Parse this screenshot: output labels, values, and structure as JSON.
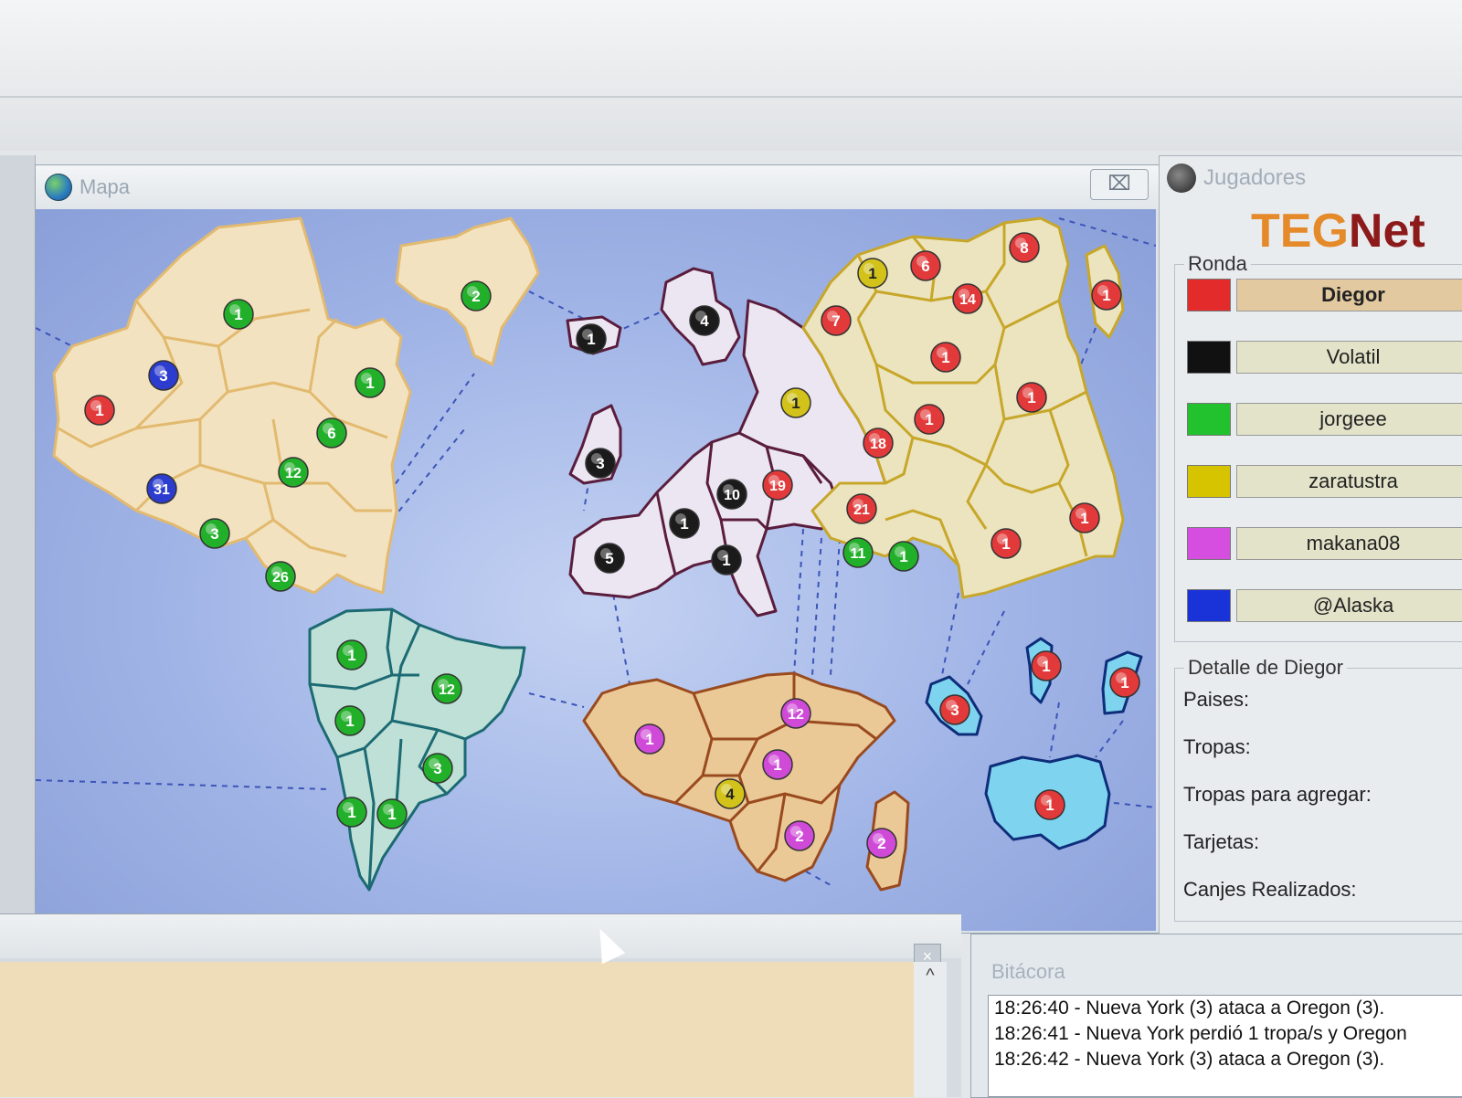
{
  "map_window": {
    "title": "Mapa",
    "close_label": "⌧"
  },
  "players_window": {
    "title": "Jugadores",
    "logo": {
      "teg": "TEG",
      "net": "Net"
    },
    "round_label": "Ronda",
    "players": [
      {
        "name": "Diegor",
        "color": "#e42b2b",
        "active": true
      },
      {
        "name": "Volatil",
        "color": "#111111",
        "active": false
      },
      {
        "name": "jorgeee",
        "color": "#22c22e",
        "active": false
      },
      {
        "name": "zaratustra",
        "color": "#d6c400",
        "active": false
      },
      {
        "name": "makana08",
        "color": "#d54ee0",
        "active": false
      },
      {
        "name": "@Alaska",
        "color": "#1a33d8",
        "active": false
      }
    ],
    "detail": {
      "title": "Detalle de Diegor",
      "labels": [
        "Paises:",
        "Tropas:",
        "Tropas para agregar:",
        "Tarjetas:",
        "Canjes Realizados:"
      ]
    }
  },
  "log_window": {
    "title": "Bitácora",
    "lines": [
      "18:26:40 - Nueva York (3) ataca a Oregon (3).",
      "18:26:41 - Nueva York perdió 1 tropa/s y Oregon",
      "18:26:42 - Nueva York (3) ataca a Oregon (3)."
    ]
  },
  "bottom_panel": {
    "close_label": "×",
    "scroll_up": "^"
  },
  "player_colors": {
    "red": "#e23a3a",
    "black": "#1b1b1b",
    "green": "#22b02a",
    "yellow": "#d2c21a",
    "pink": "#d04ad8",
    "blue": "#2b3ccf"
  },
  "continent_colors": {
    "north_america": "#f3e2bf",
    "south_america": "#bfe0d6",
    "europe": "#ece6f2",
    "asia": "#ece4bf",
    "africa": "#ebc996",
    "oceania": "#7ed3ee"
  },
  "troops": [
    {
      "v": "1",
      "c": "green"
    },
    {
      "v": "2",
      "c": "green"
    },
    {
      "v": "3",
      "c": "blue"
    },
    {
      "v": "1",
      "c": "red"
    },
    {
      "v": "1",
      "c": "green"
    },
    {
      "v": "6",
      "c": "green"
    },
    {
      "v": "31",
      "c": "blue"
    },
    {
      "v": "12",
      "c": "green"
    },
    {
      "v": "3",
      "c": "green"
    },
    {
      "v": "26",
      "c": "green"
    },
    {
      "v": "1",
      "c": "green"
    },
    {
      "v": "12",
      "c": "green"
    },
    {
      "v": "1",
      "c": "green"
    },
    {
      "v": "3",
      "c": "green"
    },
    {
      "v": "1",
      "c": "green"
    },
    {
      "v": "1",
      "c": "green"
    },
    {
      "v": "1",
      "c": "black"
    },
    {
      "v": "4",
      "c": "black"
    },
    {
      "v": "3",
      "c": "black"
    },
    {
      "v": "1",
      "c": "yellow"
    },
    {
      "v": "10",
      "c": "black"
    },
    {
      "v": "19",
      "c": "red"
    },
    {
      "v": "1",
      "c": "black"
    },
    {
      "v": "5",
      "c": "black"
    },
    {
      "v": "1",
      "c": "black"
    },
    {
      "v": "8",
      "c": "red"
    },
    {
      "v": "1",
      "c": "yellow"
    },
    {
      "v": "6",
      "c": "red"
    },
    {
      "v": "14",
      "c": "red"
    },
    {
      "v": "1",
      "c": "red"
    },
    {
      "v": "7",
      "c": "red"
    },
    {
      "v": "1",
      "c": "red"
    },
    {
      "v": "1",
      "c": "red"
    },
    {
      "v": "1",
      "c": "red"
    },
    {
      "v": "18",
      "c": "red"
    },
    {
      "v": "21",
      "c": "red"
    },
    {
      "v": "11",
      "c": "green"
    },
    {
      "v": "1",
      "c": "green"
    },
    {
      "v": "1",
      "c": "red"
    },
    {
      "v": "1",
      "c": "red"
    },
    {
      "v": "1",
      "c": "pink"
    },
    {
      "v": "12",
      "c": "pink"
    },
    {
      "v": "1",
      "c": "pink"
    },
    {
      "v": "4",
      "c": "yellow"
    },
    {
      "v": "2",
      "c": "pink"
    },
    {
      "v": "2",
      "c": "pink"
    },
    {
      "v": "3",
      "c": "red"
    },
    {
      "v": "1",
      "c": "red"
    },
    {
      "v": "1",
      "c": "red"
    },
    {
      "v": "1",
      "c": "red"
    }
  ]
}
